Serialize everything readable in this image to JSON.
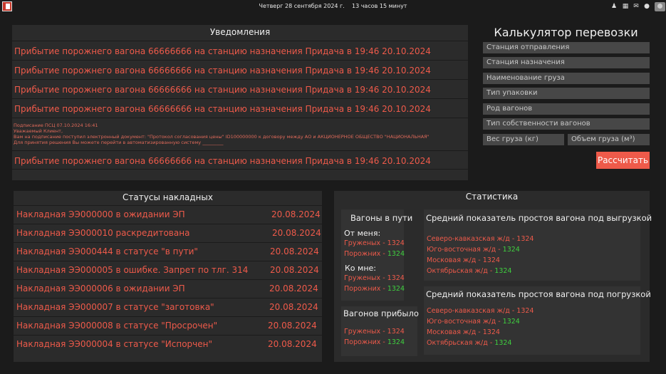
{
  "topbar": {
    "clock": "Четверг 28 сентября 2024 г.    13 часов 15 минут",
    "icons": [
      "users-icon",
      "map-icon",
      "mail-icon",
      "bell-icon",
      "avatar"
    ]
  },
  "notifications": {
    "title": "Уведомления",
    "items": [
      "Прибытие порожнего вагона 66666666 на станцию назначения Придача в 19:46 20.10.2024",
      "Прибытие порожнего вагона 66666666 на станцию назначения Придача в 19:46 20.10.2024",
      "Прибытие порожнего вагона 66666666 на станцию назначения Придача в 19:46 20.10.2024",
      "Прибытие порожнего вагона 66666666 на станцию назначения Придача в 19:46 20.10.2024"
    ],
    "long_message": {
      "line1": "Подписание ПСЦ  07.10.2024 16:41",
      "line2": "Уважаемый Клиент,",
      "line3": "Вам на подписание поступил электронный документ: \"Протокол согласования цены\"  ID100000000 к договору между АО  и АКЦИОНЕРНОЕ ОБЩЕСТВО \"НАЦИОНАЛЬНАЯ\"",
      "line4": "Для принятия решения Вы можете перейти в автоматизированную систему _________"
    },
    "last_item": "Прибытие порожнего вагона 66666666 на станцию назначения Придача в 19:46 20.10.2024"
  },
  "calculator": {
    "title": "Калькулятор перевозки",
    "fields": [
      "Станция отправления",
      "Станция назначения",
      "Наименование груза",
      "Тип упаковки",
      "Род вагонов",
      "Тип собственности вагонов"
    ],
    "weight_placeholder": "Вес груза (кг)",
    "volume_placeholder": "Объем груза (м³)",
    "button": "Рассчитать"
  },
  "statuses": {
    "title": "Статусы накладных",
    "rows": [
      {
        "name": "Накладная ЭЭ000000 в ожидании ЭП",
        "date": "20.08.2024"
      },
      {
        "name": "Накладная ЭЭ000010 раскредитована",
        "date": "20.08.2024"
      },
      {
        "name": "Накладная ЭЭ000444 в статусе \"в пути\"",
        "date": "20.08.2024"
      },
      {
        "name": "Накладная ЭЭ000005 в ошибке. Запрет по тлг. 314",
        "date": "20.08.2024"
      },
      {
        "name": "Накладная ЭЭ000006 в ожидании ЭП",
        "date": "20.08.2024"
      },
      {
        "name": "Накладная ЭЭ000007 в статусе \"заготовка\"",
        "date": "20.08.2024"
      },
      {
        "name": "Накладная ЭЭ000008 в статусе \"Просрочен\"",
        "date": "20.08.2024"
      },
      {
        "name": "Накладная ЭЭ000004 в статусе \"Испорчен\"",
        "date": "20.08.2024"
      }
    ]
  },
  "statistics": {
    "title": "Статистика",
    "wagons_in_transit": {
      "title": "Вагоны в пути",
      "from_me": "От меня:",
      "to_me": "Ко мне:",
      "loaded_label": "Груженых -",
      "empty_label": "Порожних -",
      "from_loaded": "1324",
      "from_empty": "1324",
      "to_loaded": "1324",
      "to_empty": "1324"
    },
    "wagons_arrived": {
      "title": "Вагонов прибыло",
      "loaded_label": "Груженых -",
      "empty_label": "Порожних -",
      "loaded": "1324",
      "empty": "1324"
    },
    "unloading": {
      "title": "Средний показатель простоя вагона под выгрузкой",
      "rows": [
        {
          "label": "Северо-кавказская ж/д -",
          "value": "1324",
          "color": "#ee5a4a"
        },
        {
          "label": "Юго-восточная ж/д -",
          "value": "1324",
          "color": "#3fcf3f"
        },
        {
          "label": "Московая ж/д -",
          "value": "1324",
          "color": "#ee5a4a"
        },
        {
          "label": "Октябрьская ж/д -",
          "value": "1324",
          "color": "#3fcf3f"
        }
      ]
    },
    "loading": {
      "title": "Средний показатель простоя вагона под погрузкой",
      "rows": [
        {
          "label": "Северо-кавказская ж/д -",
          "value": "1324",
          "color": "#ee5a4a"
        },
        {
          "label": "Юго-восточная ж/д -",
          "value": "1324",
          "color": "#3fcf3f"
        },
        {
          "label": "Московая ж/д -",
          "value": "1324",
          "color": "#ee5a4a"
        },
        {
          "label": "Октябрьская ж/д -",
          "value": "1324",
          "color": "#3fcf3f"
        }
      ]
    }
  }
}
